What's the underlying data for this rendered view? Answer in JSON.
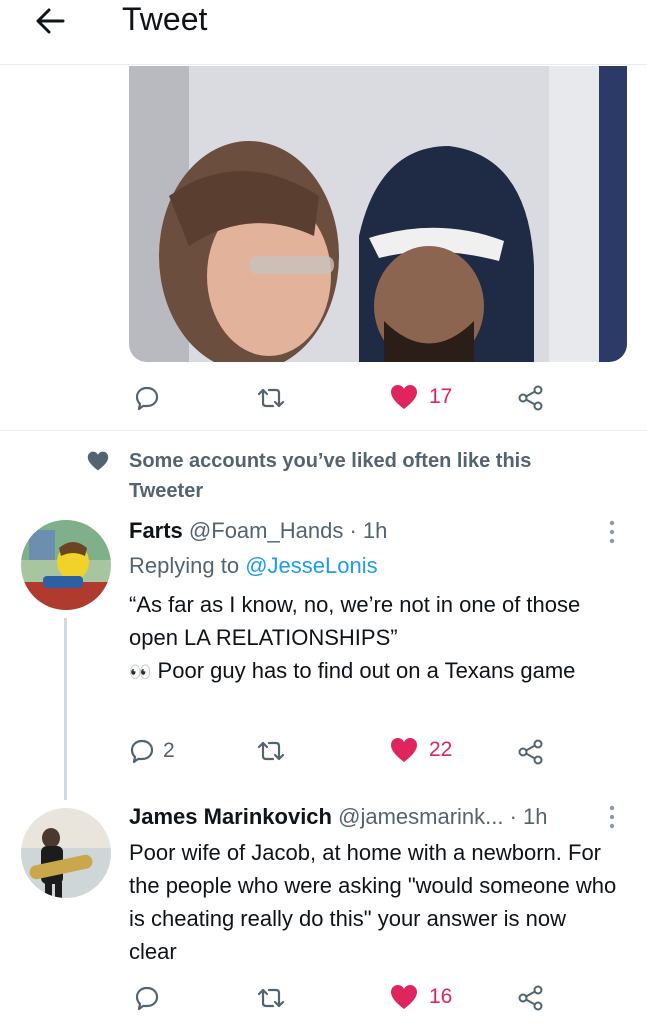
{
  "header": {
    "title": "Tweet"
  },
  "main_tweet": {
    "likes": "17"
  },
  "social_context": {
    "text": "Some accounts you’ve liked often like this Tweeter"
  },
  "replies": [
    {
      "name": "Farts",
      "handle": "@Foam_Hands",
      "time": "· 1h",
      "replying_prefix": "Replying to",
      "replying_to": "@JesseLonis",
      "line1": "“As far as I know, no, we’re not in one of those open LA RELATIONSHIPS”",
      "emoji": "👀",
      "line2": "Poor guy has to find out on a Texans game",
      "replies_count": "2",
      "likes": "22"
    },
    {
      "name": "James Marinkovich",
      "handle": "@jamesmarink...",
      "time": "· 1h",
      "text": "Poor wife of Jacob, at home with a newborn. For the people who were asking \"would someone who is cheating really do this\" your answer is now clear",
      "likes": "16"
    }
  ],
  "colors": {
    "like": "#e0245e",
    "link": "#1d9bf0",
    "secondary": "#536471"
  },
  "icons": {
    "back": "arrow-left-icon",
    "reply": "comment-icon",
    "retweet": "retweet-icon",
    "like": "heart-icon",
    "share": "share-icon",
    "more": "more-vertical-icon"
  }
}
